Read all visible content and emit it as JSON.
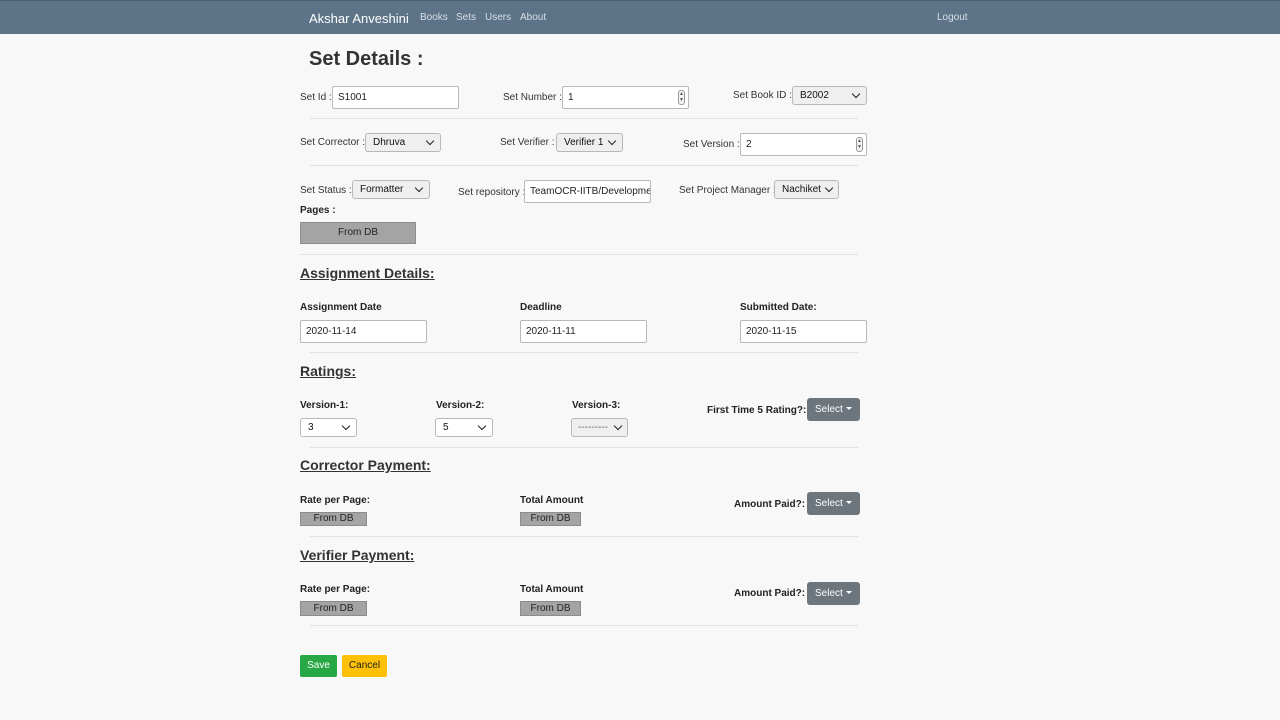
{
  "nav": {
    "brand": "Akshar Anveshini",
    "links": [
      "Books",
      "Sets",
      "Users",
      "About"
    ],
    "logout": "Logout"
  },
  "page_title": "Set Details :",
  "row1": {
    "set_id_label": "Set Id :",
    "set_id_value": "S1001",
    "set_number_label": "Set Number :",
    "set_number_value": "1",
    "set_book_id_label": "Set Book ID :",
    "set_book_id_value": "B2002"
  },
  "row2": {
    "corrector_label": "Set Corrector :",
    "corrector_value": "Dhruva",
    "verifier_label": "Set Verifier :",
    "verifier_value": "Verifier 1",
    "version_label": "Set Version :",
    "version_value": "2"
  },
  "row3": {
    "status_label": "Set Status :",
    "status_value": "Formatter",
    "repository_label": "Set repository :",
    "repository_value": "TeamOCR-IITB/Development",
    "pm_label": "Set Project Manager :",
    "pm_value": "Nachiket"
  },
  "pages": {
    "label": "Pages :",
    "button": "From DB"
  },
  "assignment": {
    "heading": "Assignment Details:",
    "assignment_date_label": "Assignment Date",
    "assignment_date_value": "2020-11-14",
    "deadline_label": "Deadline",
    "deadline_value": "2020-11-11",
    "submitted_label": "Submitted Date:",
    "submitted_value": "2020-11-15"
  },
  "ratings": {
    "heading": "Ratings:",
    "v1_label": "Version-1:",
    "v1_value": "3",
    "v2_label": "Version-2:",
    "v2_value": "5",
    "v3_label": "Version-3:",
    "v3_value": "---------",
    "first_time_label": "First Time 5 Rating?:",
    "first_time_button": "Select"
  },
  "corrector_payment": {
    "heading": "Corrector Payment:",
    "rate_label": "Rate per Page:",
    "rate_value": "From DB",
    "total_label": "Total Amount",
    "total_value": "From DB",
    "paid_label": "Amount Paid?:",
    "paid_button": "Select"
  },
  "verifier_payment": {
    "heading": "Verifier Payment:",
    "rate_label": "Rate per Page:",
    "rate_value": "From DB",
    "total_label": "Total Amount",
    "total_value": "From DB",
    "paid_label": "Amount Paid?:",
    "paid_button": "Select"
  },
  "actions": {
    "save": "Save",
    "cancel": "Cancel"
  }
}
